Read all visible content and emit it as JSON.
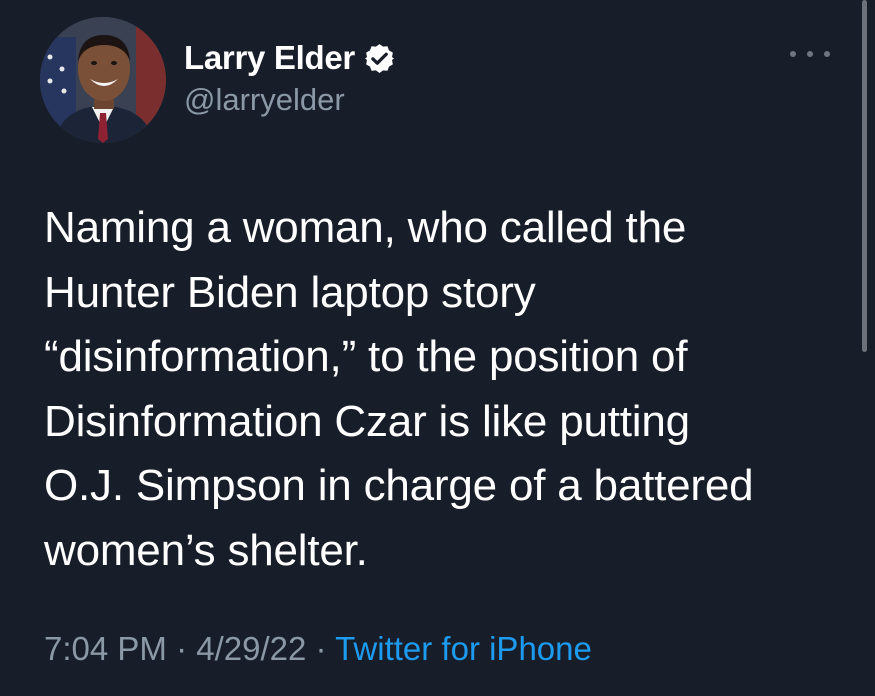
{
  "author": {
    "display_name": "Larry Elder",
    "handle": "@larryelder",
    "verified": true,
    "verified_icon": "verified-badge-icon",
    "verified_color": "#ffffff"
  },
  "tweet": {
    "lines": [
      "Naming a woman, who called the",
      "Hunter Biden laptop story",
      "“disinformation,” to the position of",
      "Disinformation Czar is like putting",
      "O.J. Simpson in charge of a battered",
      "women’s shelter."
    ]
  },
  "meta": {
    "time": "7:04 PM",
    "separator": " · ",
    "date": "4/29/22",
    "source": "Twitter for iPhone"
  },
  "colors": {
    "background": "#171e29",
    "text": "#ffffff",
    "muted": "#8b98a5",
    "link": "#1d9bf0"
  }
}
